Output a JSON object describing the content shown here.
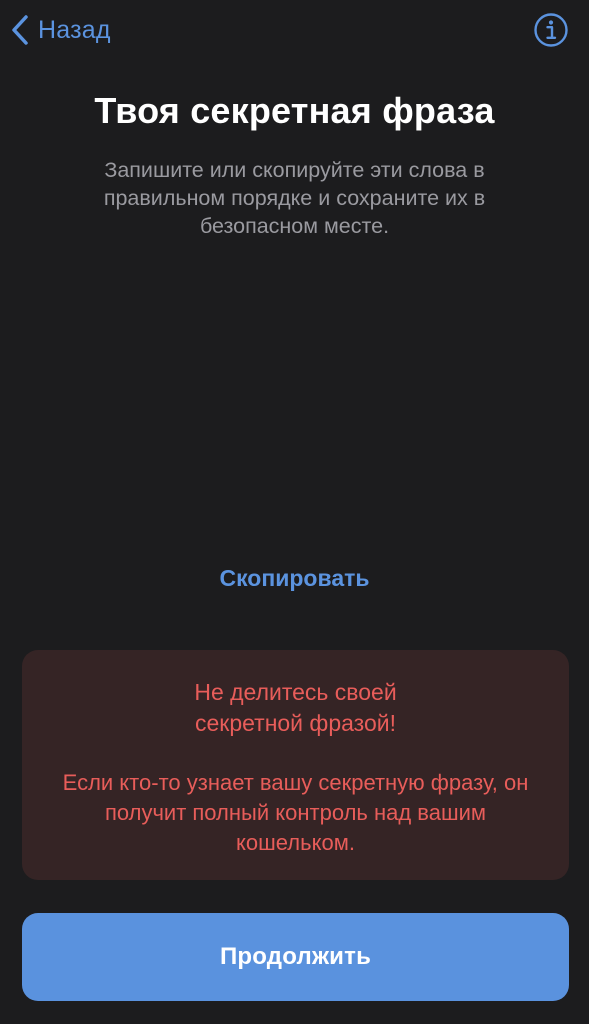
{
  "nav": {
    "back_label": "Назад",
    "back_icon": "chevron-left-icon",
    "info_icon": "info-circle-icon"
  },
  "header": {
    "title": "Твоя секретная фраза",
    "subtitle": "Запишите или скопируйте эти слова в правильном порядке и сохраните их в безопасном месте."
  },
  "actions": {
    "copy_label": "Скопировать",
    "continue_label": "Продолжить"
  },
  "warning": {
    "title_line1": "Не делитесь своей",
    "title_line2": "секретной фразой!",
    "body": "Если кто-то узнает вашу секретную фразу, он получит полный контроль над вашим кошельком."
  },
  "colors": {
    "background": "#1c1c1e",
    "accent": "#5b93df",
    "warning_text": "#e85d5a",
    "warning_background": "#352425",
    "button_background": "#5a92de"
  }
}
